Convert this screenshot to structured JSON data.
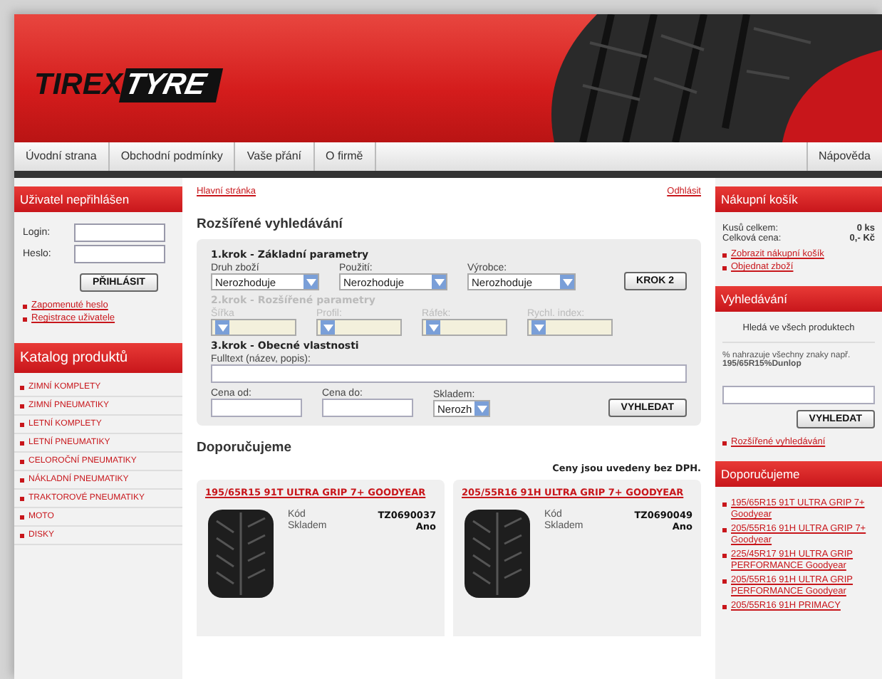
{
  "header": {
    "logo_dark": "TIREX",
    "logo_light": "TYRE"
  },
  "nav": {
    "items": [
      "Úvodní strana",
      "Obchodní podmínky",
      "Vaše přání",
      "O firmě"
    ],
    "help": "Nápověda"
  },
  "login_panel": {
    "title": "Uživatel nepřihlášen",
    "login_label": "Login:",
    "password_label": "Heslo:",
    "button": "PŘIHLÁSIT",
    "links": [
      "Zapomenuté heslo",
      "Registrace uživatele"
    ]
  },
  "catalog": {
    "title": "Katalog produktů",
    "items": [
      "ZIMNÍ KOMPLETY",
      "ZIMNÍ PNEUMATIKY",
      "LETNÍ KOMPLETY",
      "LETNÍ PNEUMATIKY",
      "CELOROČNÍ PNEUMATIKY",
      "NÁKLADNÍ PNEUMATIKY",
      "TRAKTOROVÉ PNEUMATIKY",
      "MOTO",
      "DISKY"
    ]
  },
  "breadcrumb": "Hlavní stránka",
  "logout": "Odhlásit",
  "search": {
    "title": "Rozšířené vyhledávání",
    "steps": [
      {
        "title": "1.krok - Základní parametry",
        "disabled": false,
        "button": "KROK 2",
        "fields": [
          {
            "kind": "select",
            "label": "Druh zboží",
            "value": "Nerozhoduje"
          },
          {
            "kind": "select",
            "label": "Použití:",
            "value": "Nerozhoduje"
          },
          {
            "kind": "select",
            "label": "Výrobce:",
            "value": "Nerozhoduje"
          }
        ]
      },
      {
        "title": "2.krok - Rozšířené parametry",
        "disabled": true,
        "fields": [
          {
            "kind": "select",
            "label": "Šířka"
          },
          {
            "kind": "select",
            "label": "Profil:"
          },
          {
            "kind": "select",
            "label": "Ráfek:"
          },
          {
            "kind": "select",
            "label": "Rychl. index:"
          }
        ]
      },
      {
        "title": "3.krok - Obecné vlastnosti",
        "disabled": false,
        "button": "VYHLEDAT",
        "fields": [
          {
            "kind": "wide",
            "label": "Fulltext (název, popis):"
          },
          {
            "kind": "text",
            "label": "Cena od:"
          },
          {
            "kind": "text",
            "label": "Cena do:"
          },
          {
            "kind": "small-select",
            "label": "Skladem:",
            "value": "Nerozh"
          }
        ]
      }
    ]
  },
  "recommended": {
    "title": "Doporučujeme",
    "note": "Ceny jsou uvedeny bez DPH.",
    "products": [
      {
        "title": "195/65R15 91T ULTRA GRIP 7+ GOODYEAR",
        "code_label": "Kód",
        "code": "TZ0690037",
        "stock_label": "Skladem",
        "stock": "Ano"
      },
      {
        "title": "205/55R16 91H ULTRA GRIP 7+ GOODYEAR",
        "code_label": "Kód",
        "code": "TZ0690049",
        "stock_label": "Skladem",
        "stock": "Ano"
      }
    ]
  },
  "cart": {
    "title": "Nákupní košík",
    "rows": [
      {
        "label": "Kusů celkem:",
        "value": "0 ks"
      },
      {
        "label": "Celková cena:",
        "value": "0,- Kč"
      }
    ],
    "links": [
      "Zobrazit nákupní košík",
      "Objednat zboží"
    ]
  },
  "quick_search": {
    "title": "Vyhledávání",
    "scope": "Hledá ve všech produktech",
    "hint": "% nahrazuje všechny znaky např. **195/65R15%Dunlop**",
    "button": "VYHLEDAT",
    "link": "Rozšířené vyhledávání"
  },
  "side_recommended": {
    "title": "Doporučujeme",
    "items": [
      "195/65R15 91T ULTRA GRIP 7+ Goodyear",
      "205/55R16 91H ULTRA GRIP 7+ Goodyear",
      "225/45R17 91H ULTRA GRIP PERFORMANCE Goodyear",
      "205/55R16 91H ULTRA GRIP PERFORMANCE Goodyear",
      "205/55R16 91H PRIMACY"
    ]
  }
}
